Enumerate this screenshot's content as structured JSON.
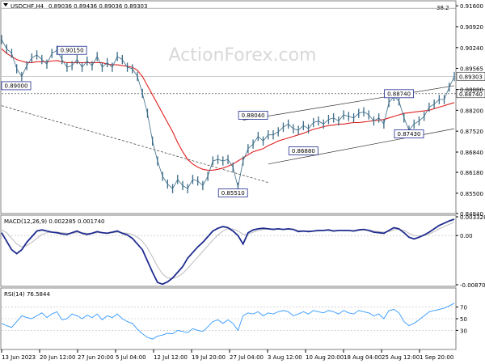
{
  "symbol_header": "USDCHF,H4",
  "ohlc_header": "0.89036 0.89436 0.89036 0.89303",
  "watermark": "ActionForex.com",
  "fib_label": "38.2",
  "colors": {
    "price": "#3b6b87",
    "ma": "#e02020",
    "macd": "#1f2c8f",
    "signal": "#bbbbbb",
    "rsi": "#3399ff",
    "box": "#1f2c8f"
  },
  "chart_data": [
    {
      "type": "line",
      "title": "USDCHF,H4",
      "ylim": [
        0.8484,
        0.9163
      ],
      "y_ticks": [
        "0.91600",
        "0.90920",
        "0.90240",
        "0.89565",
        "0.88880",
        "0.88200",
        "0.87520",
        "0.86840",
        "0.86180",
        "0.85500",
        "0.84840"
      ],
      "current_price": "0.89303",
      "level_label": "0.88740",
      "level_values": [
        0.89303,
        0.8874
      ],
      "x_labels": [
        "13 Jun 2023",
        "20 Jun 12:00",
        "27 Jun 20:00",
        "5 Jul 04:00",
        "12 Jul 12:00",
        "19 Jul 20:00",
        "27 Jul 04:00",
        "3 Aug 12:00",
        "10 Aug 20:00",
        "18 Aug 04:00",
        "25 Aug 12:00",
        "1 Sep 20:00"
      ],
      "annotations": [
        {
          "text": "0.90150",
          "value": 0.9015
        },
        {
          "text": "0.89000",
          "value": 0.89
        },
        {
          "text": "0.88040",
          "value": 0.8804
        },
        {
          "text": "0.88740",
          "value": 0.8874
        },
        {
          "text": "0.86880",
          "value": 0.8688
        },
        {
          "text": "0.87430",
          "value": 0.8743
        },
        {
          "text": "0.85510",
          "value": 0.8551
        }
      ],
      "series": [
        {
          "name": "USDCHF",
          "values": [
            0.905,
            0.902,
            0.9005,
            0.8955,
            0.893,
            0.8965,
            0.899,
            0.9,
            0.8985,
            0.897,
            0.9005,
            0.9015,
            0.8985,
            0.896,
            0.8965,
            0.8985,
            0.896,
            0.898,
            0.8965,
            0.8995,
            0.896,
            0.8975,
            0.896,
            0.8995,
            0.8985,
            0.896,
            0.8955,
            0.893,
            0.8875,
            0.881,
            0.872,
            0.8655,
            0.8605,
            0.858,
            0.8565,
            0.8595,
            0.8575,
            0.8565,
            0.8595,
            0.859,
            0.8575,
            0.8605,
            0.8655,
            0.866,
            0.8655,
            0.866,
            0.8635,
            0.857,
            0.8655,
            0.8695,
            0.871,
            0.8735,
            0.872,
            0.874,
            0.874,
            0.875,
            0.8765,
            0.8775,
            0.876,
            0.8755,
            0.877,
            0.876,
            0.878,
            0.8785,
            0.8775,
            0.879,
            0.8795,
            0.8785,
            0.8805,
            0.88,
            0.8795,
            0.881,
            0.8815,
            0.8805,
            0.8785,
            0.8795,
            0.8775,
            0.8845,
            0.8865,
            0.885,
            0.8795,
            0.8755,
            0.8775,
            0.8785,
            0.88,
            0.883,
            0.884,
            0.8855,
            0.8855,
            0.8895,
            0.893
          ]
        },
        {
          "name": "MA",
          "values": [
            0.902,
            0.9005,
            0.8995,
            0.8985,
            0.898,
            0.8975,
            0.8975,
            0.8978,
            0.8978,
            0.8978,
            0.898,
            0.8982,
            0.8978,
            0.8975,
            0.8975,
            0.8975,
            0.8975,
            0.8975,
            0.8975,
            0.8975,
            0.8975,
            0.897,
            0.8968,
            0.8968,
            0.8965,
            0.8963,
            0.896,
            0.895,
            0.893,
            0.89,
            0.887,
            0.884,
            0.881,
            0.878,
            0.875,
            0.8715,
            0.8685,
            0.866,
            0.8645,
            0.8635,
            0.8628,
            0.8625,
            0.8625,
            0.8628,
            0.8632,
            0.8638,
            0.8645,
            0.8655,
            0.8665,
            0.8675,
            0.8685,
            0.869,
            0.8695,
            0.8705,
            0.8712,
            0.872,
            0.8725,
            0.873,
            0.8735,
            0.874,
            0.8745,
            0.8752,
            0.8758,
            0.8762,
            0.8767,
            0.877,
            0.8772,
            0.8775,
            0.8775,
            0.8778,
            0.878,
            0.878,
            0.8782,
            0.8784,
            0.8786,
            0.8788,
            0.879,
            0.8795,
            0.88,
            0.8805,
            0.881,
            0.8812,
            0.8814,
            0.8816,
            0.8818,
            0.882,
            0.8825,
            0.883,
            0.8835,
            0.884,
            0.8845
          ]
        }
      ]
    },
    {
      "type": "line",
      "title": "MACD(12,26,9) 0.002285 0.001740",
      "ylim": [
        -0.008707,
        0.003328
      ],
      "y_ticks": [
        "0.003328",
        "0.00",
        "-0.008707"
      ],
      "series": [
        {
          "name": "MACD",
          "values": [
            0.0005,
            -0.001,
            -0.0025,
            -0.0032,
            -0.0025,
            -0.0012,
            -0.0002,
            0.0008,
            0.001,
            0.0008,
            0.0006,
            0.0005,
            0.0003,
            0.0002,
            0.0005,
            0.0008,
            0.0004,
            0.0002,
            0.0004,
            0.0007,
            0.0005,
            0.0004,
            0.0006,
            0.0008,
            0.0004,
            0.0001,
            -0.0005,
            -0.0015,
            -0.0025,
            -0.0045,
            -0.0065,
            -0.0083,
            -0.0086,
            -0.0082,
            -0.0075,
            -0.0065,
            -0.0055,
            -0.004,
            -0.003,
            -0.002,
            -0.0012,
            -0.0002,
            0.0008,
            0.0013,
            0.0016,
            0.0014,
            0.0008,
            0.0,
            -0.0015,
            0.0005,
            0.001,
            0.0012,
            0.0013,
            0.0012,
            0.0011,
            0.0012,
            0.0011,
            0.0012,
            0.0011,
            0.0007,
            0.0008,
            0.0007,
            0.0008,
            0.0009,
            0.0009,
            0.001,
            0.0008,
            0.0009,
            0.0009,
            0.0009,
            0.0008,
            0.001,
            0.0011,
            0.0009,
            0.0006,
            0.0005,
            0.0004,
            0.0009,
            0.0014,
            0.0012,
            0.0005,
            -0.0003,
            -0.0006,
            -0.0003,
            0.0001,
            0.0006,
            0.0012,
            0.0018,
            0.0022,
            0.0026,
            0.0029
          ]
        },
        {
          "name": "Signal",
          "values": [
            0.001,
            0.0005,
            -0.0005,
            -0.0015,
            -0.002,
            -0.0018,
            -0.0012,
            -0.0005,
            0.0002,
            0.0005,
            0.0006,
            0.0006,
            0.0005,
            0.0004,
            0.0004,
            0.0005,
            0.0005,
            0.0004,
            0.0004,
            0.0005,
            0.0005,
            0.0005,
            0.0005,
            0.0006,
            0.0005,
            0.0004,
            0.0002,
            -0.0003,
            -0.001,
            -0.0022,
            -0.0038,
            -0.0055,
            -0.0068,
            -0.0075,
            -0.0076,
            -0.0073,
            -0.0067,
            -0.0058,
            -0.0048,
            -0.0038,
            -0.0028,
            -0.0018,
            -0.0008,
            0.0001,
            0.0008,
            0.0012,
            0.0012,
            0.0008,
            0.0002,
            0.0002,
            0.0006,
            0.0009,
            0.0011,
            0.0012,
            0.0012,
            0.0012,
            0.0011,
            0.0011,
            0.0011,
            0.0009,
            0.0008,
            0.0008,
            0.0008,
            0.0008,
            0.0009,
            0.0009,
            0.0009,
            0.0009,
            0.0009,
            0.0009,
            0.0009,
            0.0009,
            0.001,
            0.001,
            0.0008,
            0.0007,
            0.0006,
            0.0007,
            0.001,
            0.0011,
            0.0009,
            0.0004,
            0.0,
            -0.0001,
            0.0,
            0.0003,
            0.0007,
            0.0012,
            0.0016,
            0.002,
            0.0024
          ]
        }
      ]
    },
    {
      "type": "line",
      "title": "RSI(14) 76.5844",
      "ylim": [
        0,
        100
      ],
      "y_ticks": [
        "70",
        "50",
        "30"
      ],
      "reference_levels": [
        70,
        50,
        30
      ],
      "series": [
        {
          "name": "RSI(14)",
          "values": [
            42,
            38,
            35,
            45,
            55,
            52,
            50,
            55,
            60,
            52,
            58,
            62,
            48,
            50,
            58,
            55,
            50,
            56,
            52,
            58,
            48,
            55,
            52,
            58,
            50,
            45,
            42,
            32,
            24,
            18,
            15,
            20,
            22,
            25,
            24,
            30,
            28,
            26,
            33,
            30,
            28,
            36,
            45,
            48,
            42,
            48,
            42,
            30,
            55,
            60,
            58,
            62,
            55,
            60,
            58,
            62,
            64,
            62,
            55,
            58,
            62,
            58,
            64,
            62,
            60,
            64,
            62,
            58,
            64,
            60,
            58,
            64,
            62,
            60,
            55,
            58,
            50,
            64,
            66,
            60,
            45,
            38,
            42,
            48,
            55,
            62,
            64,
            66,
            68,
            72,
            76.6
          ]
        }
      ]
    }
  ]
}
